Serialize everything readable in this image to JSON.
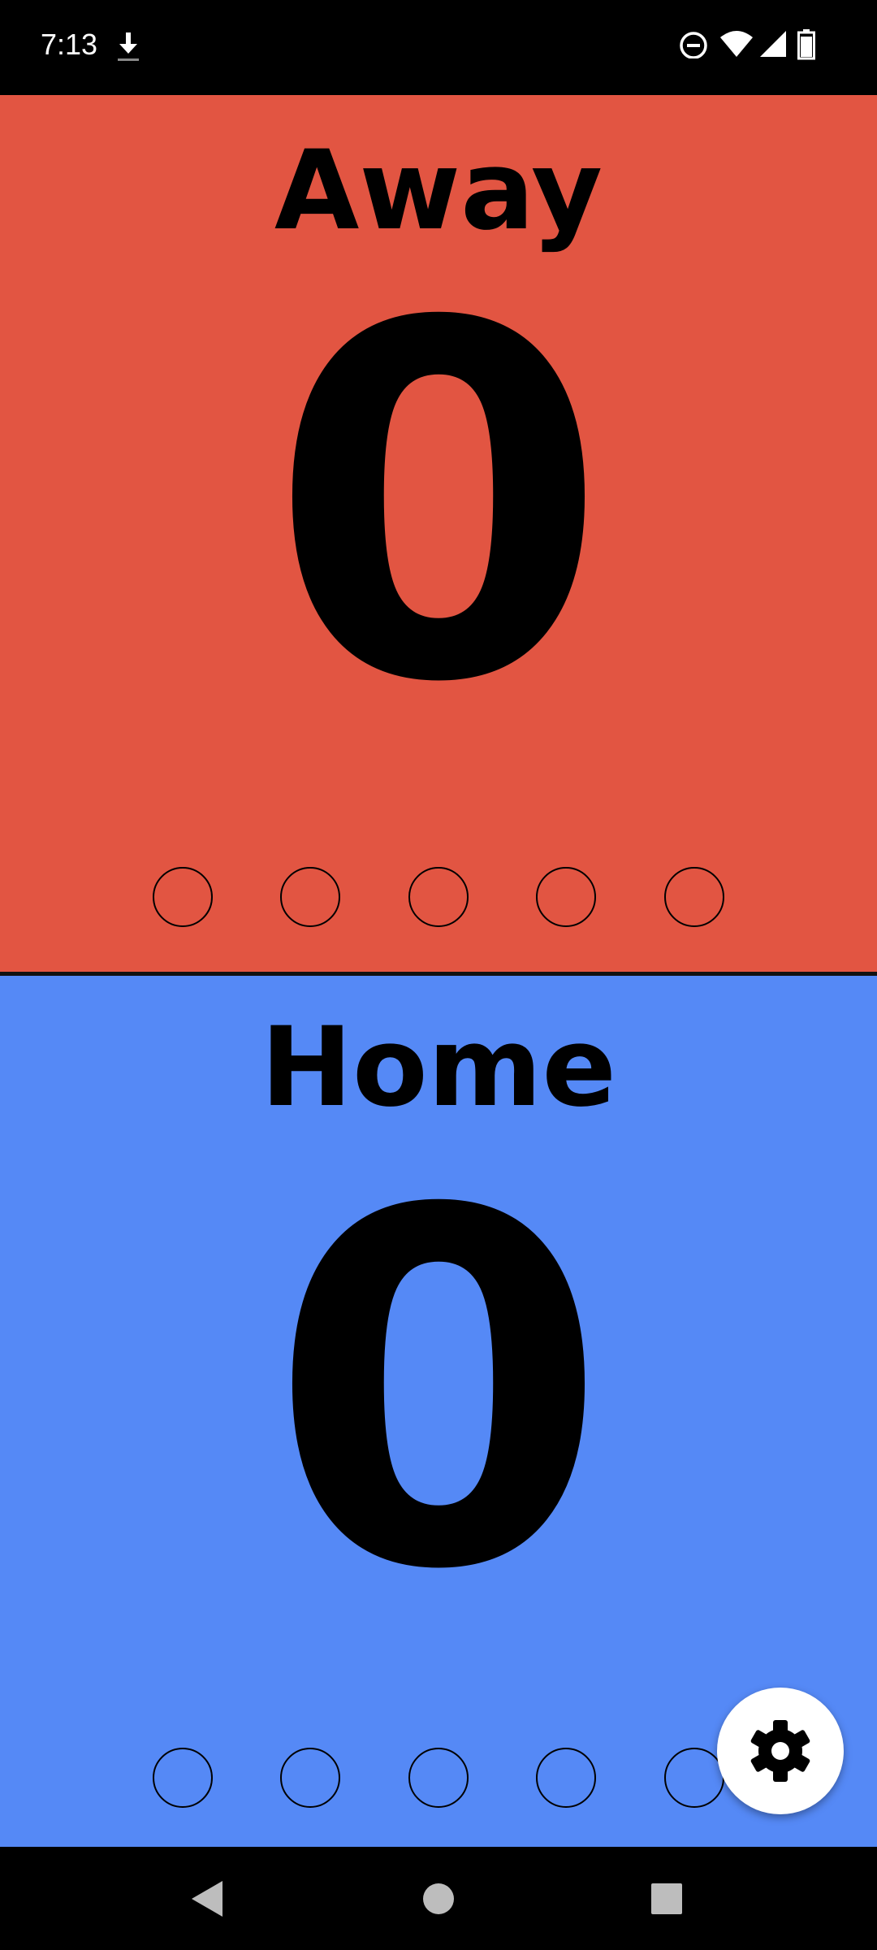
{
  "status_bar": {
    "time": "7:13",
    "icons": [
      "download-icon",
      "do-not-disturb-icon",
      "wifi-icon",
      "signal-icon",
      "battery-icon"
    ]
  },
  "away": {
    "label": "Away",
    "score": "0",
    "background_color": "#E25542",
    "period_dots": 5
  },
  "home": {
    "label": "Home",
    "score": "0",
    "background_color": "#5589F6",
    "period_dots": 5
  },
  "fab": {
    "icon": "settings-gear-icon"
  },
  "nav_bar": {
    "buttons": [
      "back-icon",
      "home-icon",
      "recents-icon"
    ]
  }
}
